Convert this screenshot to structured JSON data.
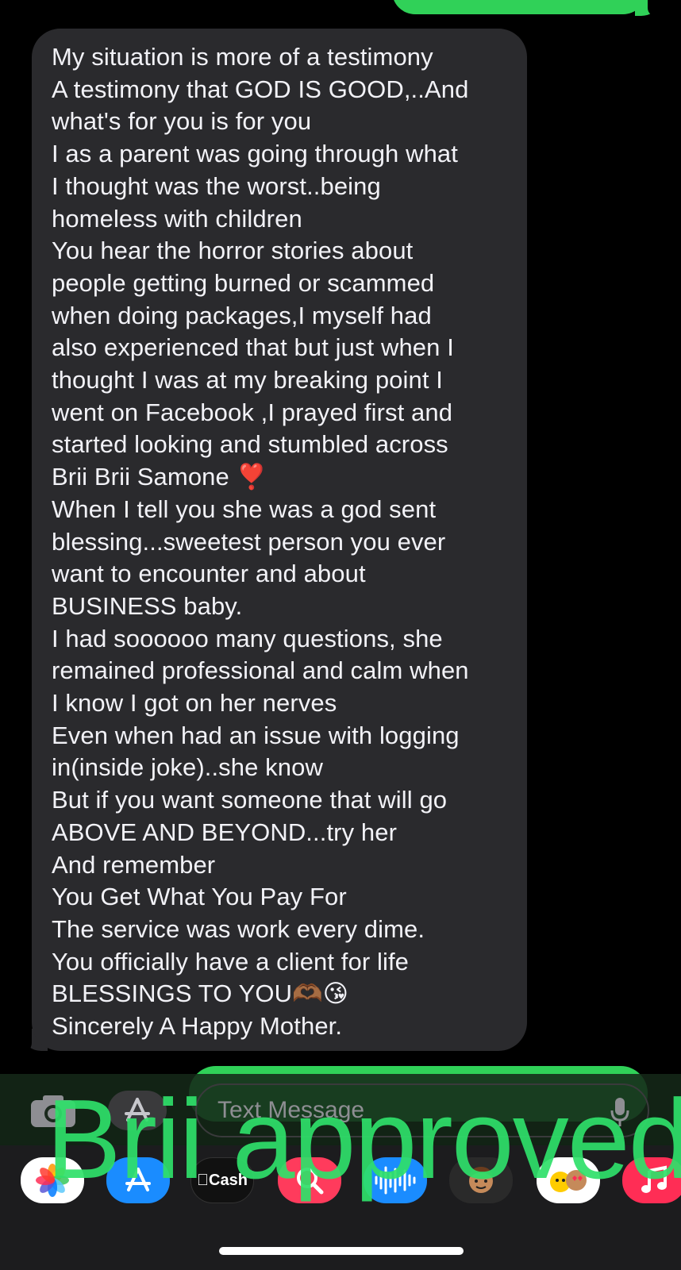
{
  "conversation": {
    "received_message_lines": [
      "My situation is more of a testimony",
      "A testimony that GOD IS GOOD,..And",
      "what's for you is for you",
      "I as a parent was going through what",
      "I thought was the worst..being",
      "homeless with children",
      "You hear the horror stories about",
      "people getting burned or scammed",
      "when doing packages,I myself had",
      "also experienced that but just when I",
      "thought I was at my breaking point I",
      "went on Facebook ,I prayed first and",
      "started looking and stumbled across",
      "Brii Brii Samone ❣️",
      "When I tell you she was a god sent",
      "blessing...sweetest person you ever",
      "want to encounter and about",
      "BUSINESS baby.",
      "I had soooooo many questions, she",
      "remained professional and calm when",
      "I know I got on her nerves",
      "Even when had an issue with logging",
      "in(inside joke)..she know",
      "But if you want someone that will go",
      "ABOVE AND BEYOND...try her",
      "And remember",
      "You Get What You Pay For",
      "The service was work every dime.",
      "You officially have a client for life",
      "BLESSINGS TO YOU🫶🏾😘",
      "Sincerely A Happy Mother."
    ]
  },
  "input_bar": {
    "placeholder": "Text Message",
    "camera_icon": "camera-icon",
    "apps_icon": "app-store-icon",
    "mic_icon": "microphone-icon"
  },
  "app_drawer": {
    "apps": [
      {
        "name": "photos-icon",
        "bg": "#ffffff"
      },
      {
        "name": "app-store-icon",
        "bg": "#1a8cff"
      },
      {
        "name": "apple-cash-icon",
        "bg": "#111111",
        "label": "Cash"
      },
      {
        "name": "image-search-icon",
        "bg": "#ff3b5c"
      },
      {
        "name": "audio-message-icon",
        "bg": "#1a8cff"
      },
      {
        "name": "memoji-icon",
        "bg": "#2a2a2a"
      },
      {
        "name": "memoji-stickers-icon",
        "bg": "#ffffff"
      },
      {
        "name": "music-icon",
        "bg": "#ff2d55"
      }
    ]
  },
  "watermark": {
    "text": "Brii approved"
  },
  "colors": {
    "sent_bubble": "#30d158",
    "received_bubble": "#2a2a2d",
    "watermark": "#2fe06a"
  }
}
